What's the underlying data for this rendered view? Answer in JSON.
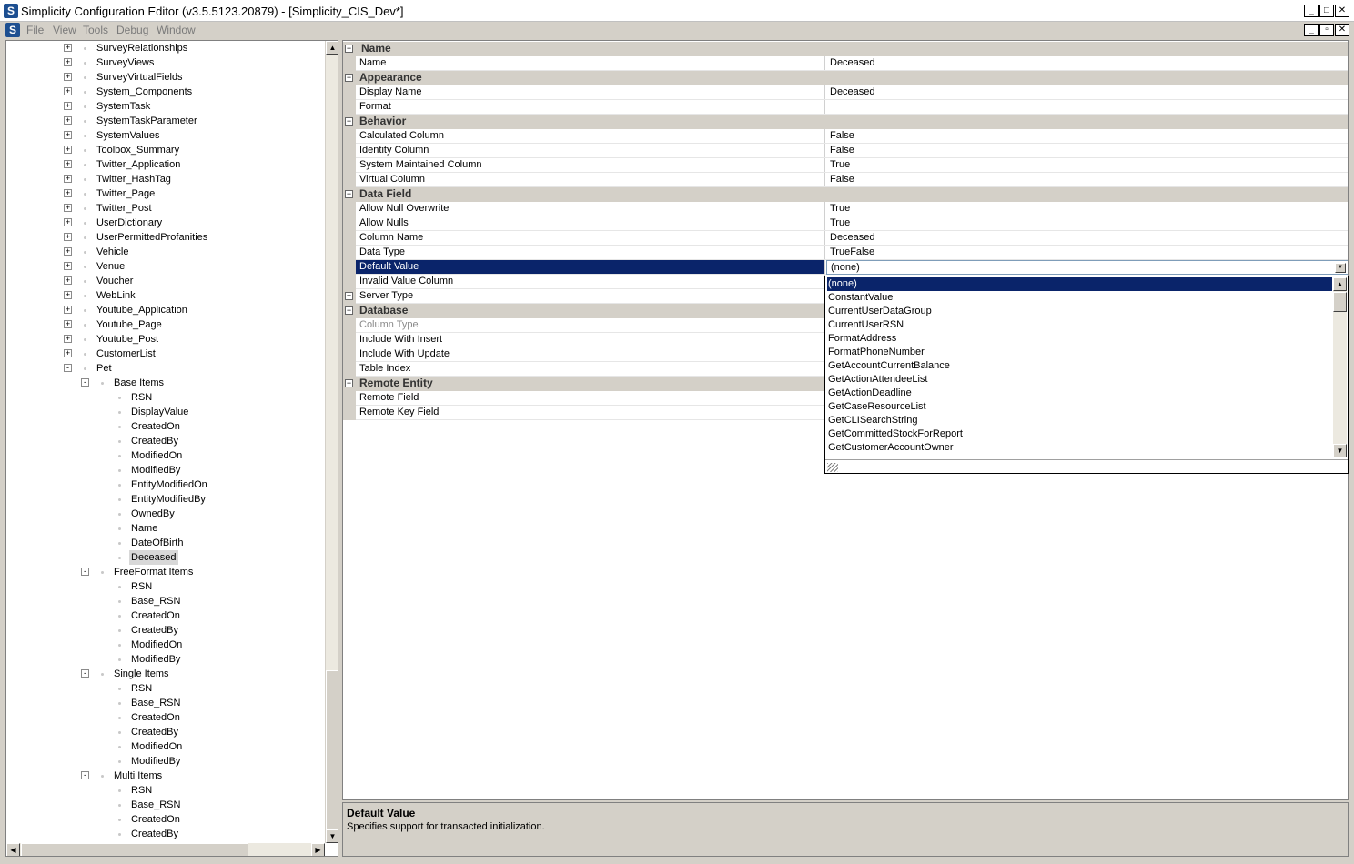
{
  "window": {
    "title": "Simplicity Configuration Editor (v3.5.5123.20879) - [Simplicity_CIS_Dev*]",
    "app_icon": "S"
  },
  "menu": [
    "File",
    "View",
    "Tools",
    "Debug",
    "Window"
  ],
  "tree": {
    "items": [
      {
        "label": "SurveyRelationships",
        "level": 0,
        "expander": "+"
      },
      {
        "label": "SurveyViews",
        "level": 0,
        "expander": "+"
      },
      {
        "label": "SurveyVirtualFields",
        "level": 0,
        "expander": "+"
      },
      {
        "label": "System_Components",
        "level": 0,
        "expander": "+"
      },
      {
        "label": "SystemTask",
        "level": 0,
        "expander": "+"
      },
      {
        "label": "SystemTaskParameter",
        "level": 0,
        "expander": "+"
      },
      {
        "label": "SystemValues",
        "level": 0,
        "expander": "+"
      },
      {
        "label": "Toolbox_Summary",
        "level": 0,
        "expander": "+"
      },
      {
        "label": "Twitter_Application",
        "level": 0,
        "expander": "+"
      },
      {
        "label": "Twitter_HashTag",
        "level": 0,
        "expander": "+"
      },
      {
        "label": "Twitter_Page",
        "level": 0,
        "expander": "+"
      },
      {
        "label": "Twitter_Post",
        "level": 0,
        "expander": "+"
      },
      {
        "label": "UserDictionary",
        "level": 0,
        "expander": "+"
      },
      {
        "label": "UserPermittedProfanities",
        "level": 0,
        "expander": "+"
      },
      {
        "label": "Vehicle",
        "level": 0,
        "expander": "+"
      },
      {
        "label": "Venue",
        "level": 0,
        "expander": "+"
      },
      {
        "label": "Voucher",
        "level": 0,
        "expander": "+"
      },
      {
        "label": "WebLink",
        "level": 0,
        "expander": "+"
      },
      {
        "label": "Youtube_Application",
        "level": 0,
        "expander": "+"
      },
      {
        "label": "Youtube_Page",
        "level": 0,
        "expander": "+"
      },
      {
        "label": "Youtube_Post",
        "level": 0,
        "expander": "+"
      },
      {
        "label": "CustomerList",
        "level": 0,
        "expander": "+"
      },
      {
        "label": "Pet",
        "level": 0,
        "expander": "-"
      },
      {
        "label": "Base Items",
        "level": 1,
        "expander": "-"
      },
      {
        "label": "RSN",
        "level": 2,
        "expander": ""
      },
      {
        "label": "DisplayValue",
        "level": 2,
        "expander": ""
      },
      {
        "label": "CreatedOn",
        "level": 2,
        "expander": ""
      },
      {
        "label": "CreatedBy",
        "level": 2,
        "expander": ""
      },
      {
        "label": "ModifiedOn",
        "level": 2,
        "expander": ""
      },
      {
        "label": "ModifiedBy",
        "level": 2,
        "expander": ""
      },
      {
        "label": "EntityModifiedOn",
        "level": 2,
        "expander": ""
      },
      {
        "label": "EntityModifiedBy",
        "level": 2,
        "expander": ""
      },
      {
        "label": "OwnedBy",
        "level": 2,
        "expander": ""
      },
      {
        "label": "Name",
        "level": 2,
        "expander": ""
      },
      {
        "label": "DateOfBirth",
        "level": 2,
        "expander": ""
      },
      {
        "label": "Deceased",
        "level": 2,
        "expander": "",
        "selected": true
      },
      {
        "label": "FreeFormat Items",
        "level": 1,
        "expander": "-"
      },
      {
        "label": "RSN",
        "level": 2,
        "expander": ""
      },
      {
        "label": "Base_RSN",
        "level": 2,
        "expander": ""
      },
      {
        "label": "CreatedOn",
        "level": 2,
        "expander": ""
      },
      {
        "label": "CreatedBy",
        "level": 2,
        "expander": ""
      },
      {
        "label": "ModifiedOn",
        "level": 2,
        "expander": ""
      },
      {
        "label": "ModifiedBy",
        "level": 2,
        "expander": ""
      },
      {
        "label": "Single Items",
        "level": 1,
        "expander": "-"
      },
      {
        "label": "RSN",
        "level": 2,
        "expander": ""
      },
      {
        "label": "Base_RSN",
        "level": 2,
        "expander": ""
      },
      {
        "label": "CreatedOn",
        "level": 2,
        "expander": ""
      },
      {
        "label": "CreatedBy",
        "level": 2,
        "expander": ""
      },
      {
        "label": "ModifiedOn",
        "level": 2,
        "expander": ""
      },
      {
        "label": "ModifiedBy",
        "level": 2,
        "expander": ""
      },
      {
        "label": "Multi Items",
        "level": 1,
        "expander": "-"
      },
      {
        "label": "RSN",
        "level": 2,
        "expander": ""
      },
      {
        "label": "Base_RSN",
        "level": 2,
        "expander": ""
      },
      {
        "label": "CreatedOn",
        "level": 2,
        "expander": ""
      },
      {
        "label": "CreatedBy",
        "level": 2,
        "expander": ""
      }
    ]
  },
  "properties": [
    {
      "type": "category",
      "label": "Name"
    },
    {
      "type": "prop",
      "name": "Name",
      "value": "Deceased"
    },
    {
      "type": "category",
      "label": "Appearance"
    },
    {
      "type": "prop",
      "name": "Display Name",
      "value": "Deceased"
    },
    {
      "type": "prop",
      "name": "Format",
      "value": ""
    },
    {
      "type": "category",
      "label": "Behavior"
    },
    {
      "type": "prop",
      "name": "Calculated Column",
      "value": "False"
    },
    {
      "type": "prop",
      "name": "Identity Column",
      "value": "False"
    },
    {
      "type": "prop",
      "name": "System Maintained Column",
      "value": "True"
    },
    {
      "type": "prop",
      "name": "Virtual Column",
      "value": "False"
    },
    {
      "type": "category",
      "label": "Data Field"
    },
    {
      "type": "prop",
      "name": "Allow Null Overwrite",
      "value": "True"
    },
    {
      "type": "prop",
      "name": "Allow Nulls",
      "value": "True"
    },
    {
      "type": "prop",
      "name": "Column Name",
      "value": "Deceased"
    },
    {
      "type": "prop",
      "name": "Data Type",
      "value": "TrueFalse"
    },
    {
      "type": "prop",
      "name": "Default Value",
      "value": "(none)",
      "selected": true
    },
    {
      "type": "prop",
      "name": "Invalid Value Column",
      "value": ""
    },
    {
      "type": "prop",
      "name": "Server Type",
      "value": "",
      "expander": "+"
    },
    {
      "type": "category",
      "label": "Database"
    },
    {
      "type": "prop",
      "name": "Column Type",
      "value": "",
      "dim": true
    },
    {
      "type": "prop",
      "name": "Include With Insert",
      "value": ""
    },
    {
      "type": "prop",
      "name": "Include With Update",
      "value": ""
    },
    {
      "type": "prop",
      "name": "Table Index",
      "value": ""
    },
    {
      "type": "category",
      "label": "Remote Entity"
    },
    {
      "type": "prop",
      "name": "Remote Field",
      "value": ""
    },
    {
      "type": "prop",
      "name": "Remote Key Field",
      "value": ""
    }
  ],
  "dropdown": {
    "selected": "(none)",
    "items": [
      "(none)",
      "ConstantValue",
      "CurrentUserDataGroup",
      "CurrentUserRSN",
      "FormatAddress",
      "FormatPhoneNumber",
      "GetAccountCurrentBalance",
      "GetActionAttendeeList",
      "GetActionDeadline",
      "GetCaseResourceList",
      "GetCLISearchString",
      "GetCommittedStockForReport",
      "GetCustomerAccountOwner"
    ]
  },
  "help": {
    "title": "Default Value",
    "description": "Specifies support for transacted initialization."
  },
  "colors": {
    "selection": "#0a246a",
    "chrome": "#d4d0c8"
  },
  "icons": {
    "app": "app-logo-icon",
    "minimize": "minimize-icon",
    "maximize": "maximize-icon",
    "close": "close-icon"
  }
}
